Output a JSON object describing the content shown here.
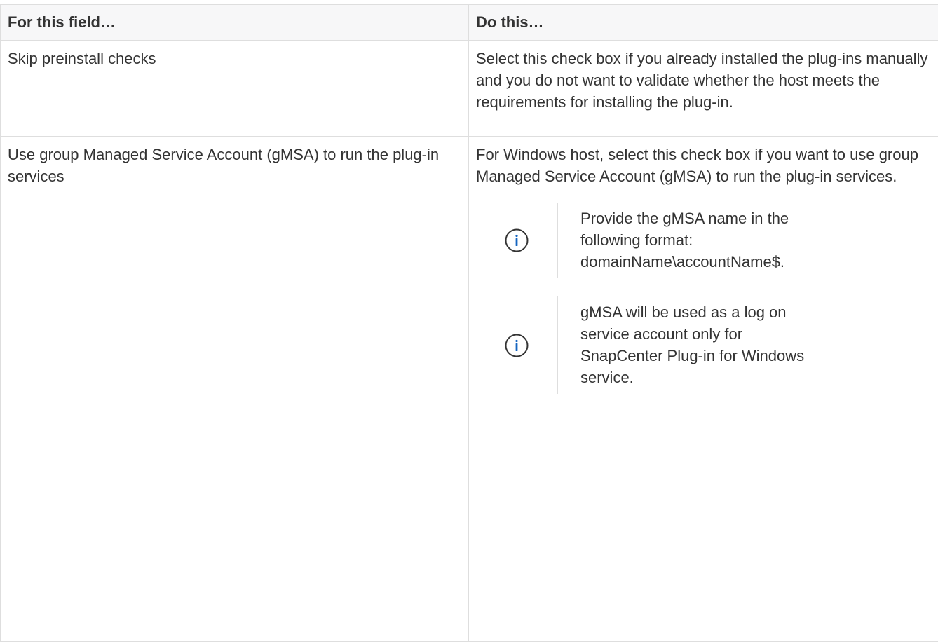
{
  "table": {
    "header": {
      "col1": "For this field…",
      "col2": "Do this…"
    },
    "rows": [
      {
        "field": "Skip preinstall checks",
        "action": "Select this check box if you already installed the plug-ins manually and you do not want to validate whether the host meets the requirements for installing the plug-in."
      },
      {
        "field": "Use group Managed Service Account (gMSA) to run the plug-in services",
        "action": "For Windows host, select this check box if you want to use group Managed Service Account (gMSA) to run the plug-in services.",
        "notes": [
          {
            "icon": "info-icon",
            "text": "Provide the gMSA name in the following format: domainName\\accountName$."
          },
          {
            "icon": "info-icon",
            "text": "gMSA will be used as a log on service account only for SnapCenter Plug-in for Windows service."
          }
        ]
      }
    ]
  },
  "colors": {
    "text": "#333333",
    "header_bg": "#f7f7f8",
    "border": "#dedede",
    "icon": "#1565c0"
  }
}
